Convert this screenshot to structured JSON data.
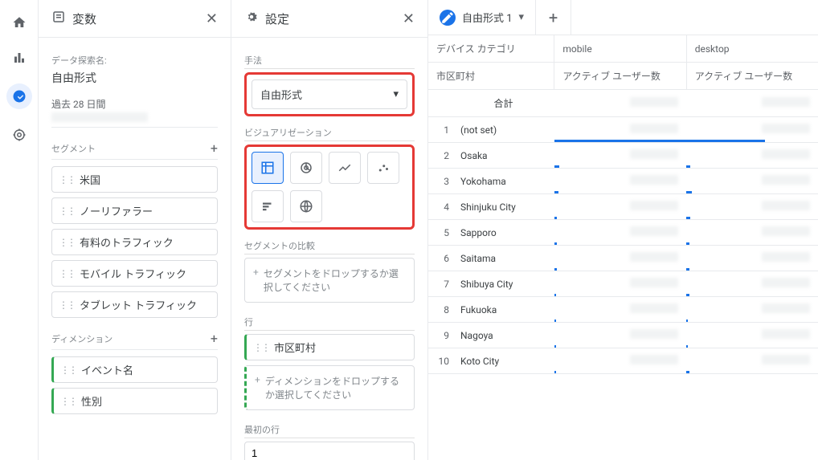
{
  "nav": {
    "items": [
      "home",
      "analytics",
      "explore",
      "realtime"
    ]
  },
  "vars_panel": {
    "title": "変数",
    "exploration_label": "データ探索名:",
    "exploration_name": "自由形式",
    "date_label": "過去 28 日間",
    "segments": {
      "label": "セグメント",
      "items": [
        "米国",
        "ノーリファラー",
        "有料のトラフィック",
        "モバイル トラフィック",
        "タブレット トラフィック"
      ]
    },
    "dimensions": {
      "label": "ディメンション",
      "items": [
        "イベント名",
        "性別"
      ]
    }
  },
  "settings_panel": {
    "title": "設定",
    "technique_label": "手法",
    "technique_value": "自由形式",
    "viz_label": "ビジュアリゼーション",
    "seg_compare_label": "セグメントの比較",
    "seg_compare_drop": "セグメントをドロップするか選択してください",
    "rows_label": "行",
    "rows_chip": "市区町村",
    "rows_drop": "ディメンションをドロップするか選択してください",
    "start_row_label": "最初の行",
    "start_row_value": "1"
  },
  "main": {
    "tab_name": "自由形式 1",
    "header_dim": "デバイス カテゴリ",
    "header_row": "市区町村",
    "col_mobile": "mobile",
    "col_desktop": "desktop",
    "metric_label": "アクティブ ユーザー数",
    "total_label": "合計",
    "rows": [
      {
        "idx": 1,
        "city": "(not set)",
        "m": 100,
        "d": 60
      },
      {
        "idx": 2,
        "city": "Osaka",
        "m": 4,
        "d": 3
      },
      {
        "idx": 3,
        "city": "Yokohama",
        "m": 3,
        "d": 4
      },
      {
        "idx": 4,
        "city": "Shinjuku City",
        "m": 2,
        "d": 3
      },
      {
        "idx": 5,
        "city": "Sapporo",
        "m": 2,
        "d": 2
      },
      {
        "idx": 6,
        "city": "Saitama",
        "m": 2,
        "d": 2
      },
      {
        "idx": 7,
        "city": "Shibuya City",
        "m": 1,
        "d": 2
      },
      {
        "idx": 8,
        "city": "Fukuoka",
        "m": 1,
        "d": 1
      },
      {
        "idx": 9,
        "city": "Nagoya",
        "m": 1,
        "d": 1
      },
      {
        "idx": 10,
        "city": "Koto City",
        "m": 1,
        "d": 2
      }
    ]
  },
  "chart_data": {
    "type": "table",
    "row_dimension": "市区町村",
    "column_dimension": "デバイス カテゴリ",
    "metric": "アクティブ ユーザー数",
    "columns": [
      "mobile",
      "desktop"
    ],
    "note": "metric values redacted/blurred in source image; bar widths are relative estimates only",
    "rows": [
      {
        "city": "(not set)",
        "mobile_rel": 100,
        "desktop_rel": 60
      },
      {
        "city": "Osaka",
        "mobile_rel": 4,
        "desktop_rel": 3
      },
      {
        "city": "Yokohama",
        "mobile_rel": 3,
        "desktop_rel": 4
      },
      {
        "city": "Shinjuku City",
        "mobile_rel": 2,
        "desktop_rel": 3
      },
      {
        "city": "Sapporo",
        "mobile_rel": 2,
        "desktop_rel": 2
      },
      {
        "city": "Saitama",
        "mobile_rel": 2,
        "desktop_rel": 2
      },
      {
        "city": "Shibuya City",
        "mobile_rel": 1,
        "desktop_rel": 2
      },
      {
        "city": "Fukuoka",
        "mobile_rel": 1,
        "desktop_rel": 1
      },
      {
        "city": "Nagoya",
        "mobile_rel": 1,
        "desktop_rel": 1
      },
      {
        "city": "Koto City",
        "mobile_rel": 1,
        "desktop_rel": 2
      }
    ]
  }
}
